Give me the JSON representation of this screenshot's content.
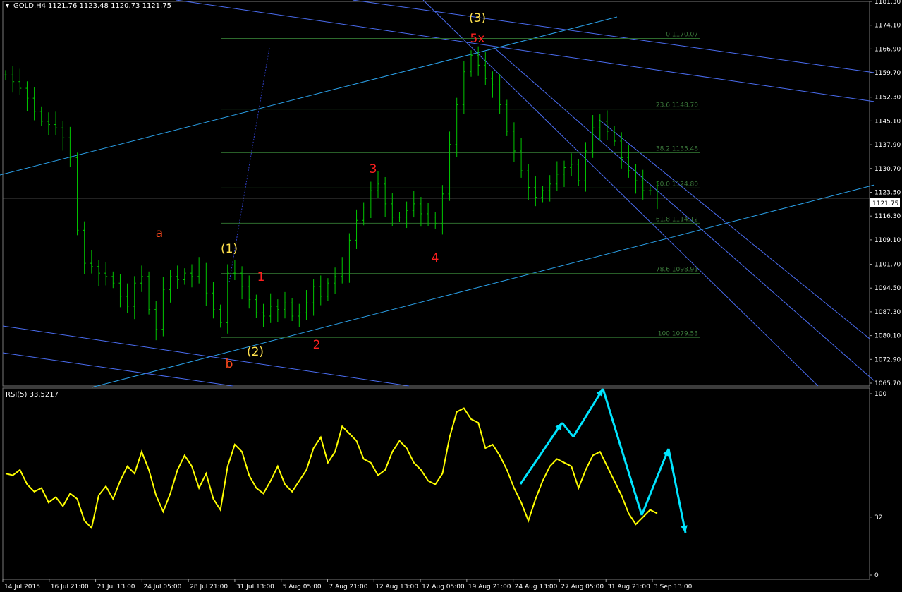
{
  "header": {
    "symbol_title": "GOLD,H4",
    "ohlc": "1121.76 1123.48 1120.73 1121.75",
    "current_price": "1121.75",
    "rsi_title": "RSI(5) 33.5217"
  },
  "colors": {
    "background": "#000000",
    "candles": "#00c800",
    "channel_lines": "#4a6cf0",
    "trend_lines": "#2aa0e8",
    "fib_lines": "#2e6b2e",
    "rsi_line": "#ffff00",
    "arrows": "#00e5ff",
    "labels_red": "#ff2020",
    "labels_orange": "#ff4a1e",
    "labels_yellow": "#ffe14d"
  },
  "chart_data": [
    {
      "type": "candlestick",
      "title": "GOLD,H4",
      "ylim": [
        1065.7,
        1181.3
      ],
      "y_ticks": [
        "1181.30",
        "1174.10",
        "1166.90",
        "1159.70",
        "1152.30",
        "1145.10",
        "1137.90",
        "1130.70",
        "1123.50",
        "1116.30",
        "1109.10",
        "1101.70",
        "1094.50",
        "1087.30",
        "1080.10",
        "1072.90",
        "1065.70"
      ],
      "x_ticks": [
        "14 Jul 2015",
        "16 Jul 21:00",
        "21 Jul 13:00",
        "24 Jul 05:00",
        "28 Jul 21:00",
        "31 Jul 13:00",
        "5 Aug 05:00",
        "7 Aug 21:00",
        "12 Aug 13:00",
        "17 Aug 05:00",
        "19 Aug 21:00",
        "24 Aug 13:00",
        "27 Aug 05:00",
        "31 Aug 21:00",
        "3 Sep 13:00"
      ],
      "close_path": [
        1159,
        1157,
        1155,
        1152,
        1148,
        1145,
        1144,
        1143,
        1140,
        1134,
        1112,
        1102,
        1101,
        1099,
        1098,
        1096,
        1092,
        1089,
        1096,
        1098,
        1088,
        1082,
        1094,
        1098,
        1097,
        1099,
        1098,
        1100,
        1093,
        1088,
        1084,
        1099,
        1099,
        1095,
        1091,
        1087,
        1086,
        1089,
        1088,
        1090,
        1086,
        1087,
        1090,
        1095,
        1092,
        1096,
        1098,
        1100,
        1109,
        1115,
        1119,
        1124,
        1126,
        1120,
        1116,
        1116,
        1118,
        1120,
        1117,
        1116,
        1114,
        1123,
        1138,
        1150,
        1160,
        1165,
        1162,
        1158,
        1156,
        1150,
        1142,
        1136,
        1130,
        1125,
        1122,
        1124,
        1126,
        1129,
        1131,
        1132,
        1127,
        1136,
        1143,
        1145,
        1142,
        1139,
        1134,
        1130,
        1127,
        1124,
        1124,
        1121.75
      ],
      "fibonacci": [
        {
          "level": "0",
          "price": 1170.07
        },
        {
          "level": "23.6",
          "price": 1148.7
        },
        {
          "level": "38.2",
          "price": 1135.48
        },
        {
          "level": "50.0",
          "price": 1124.8
        },
        {
          "level": "61.8",
          "price": 1114.12
        },
        {
          "level": "78.6",
          "price": 1098.91
        },
        {
          "level": "100",
          "price": 1079.53
        }
      ],
      "wave_labels": [
        {
          "text": "(3)",
          "color": "yellow"
        },
        {
          "text": "5x",
          "color": "red"
        },
        {
          "text": "3",
          "color": "red"
        },
        {
          "text": "a",
          "color": "orange"
        },
        {
          "text": "(1)",
          "color": "yellow"
        },
        {
          "text": "1",
          "color": "red"
        },
        {
          "text": "4",
          "color": "red"
        },
        {
          "text": "2",
          "color": "red"
        },
        {
          "text": "(2)",
          "color": "yellow"
        },
        {
          "text": "b",
          "color": "orange"
        }
      ]
    },
    {
      "type": "line",
      "title": "RSI(5) 33.5217",
      "ylim": [
        0,
        100
      ],
      "y_ticks": [
        "100",
        "32",
        "0"
      ],
      "values": [
        56,
        55,
        58,
        50,
        46,
        48,
        40,
        43,
        38,
        45,
        42,
        30,
        26,
        44,
        49,
        42,
        52,
        60,
        56,
        68,
        58,
        44,
        35,
        45,
        58,
        66,
        60,
        48,
        56,
        42,
        36,
        60,
        72,
        68,
        55,
        48,
        45,
        52,
        60,
        50,
        46,
        52,
        58,
        70,
        76,
        62,
        68,
        82,
        78,
        74,
        64,
        62,
        55,
        58,
        68,
        74,
        70,
        62,
        58,
        52,
        50,
        56,
        76,
        90,
        92,
        86,
        84,
        70,
        72,
        66,
        58,
        48,
        40,
        30,
        42,
        52,
        60,
        64,
        62,
        60,
        48,
        58,
        66,
        68,
        60,
        52,
        44,
        34,
        28,
        32,
        36,
        34
      ]
    }
  ]
}
